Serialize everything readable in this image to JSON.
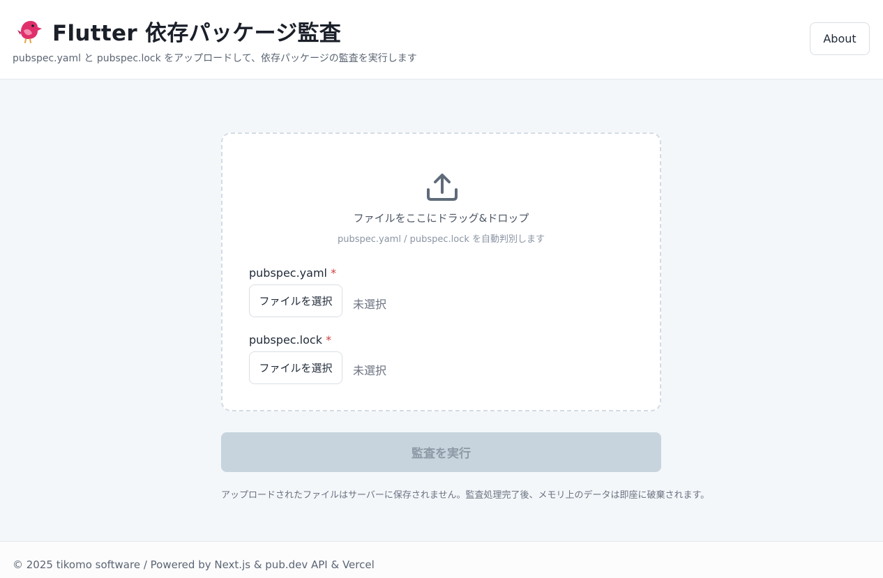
{
  "header": {
    "title": "Flutter 依存パッケージ監査",
    "subtitle": "pubspec.yaml と pubspec.lock をアップロードして、依存パッケージの監査を実行します",
    "logo_icon": "bird-logo-icon",
    "about_label": "About"
  },
  "dropzone": {
    "icon": "upload-icon",
    "main_text": "ファイルをここにドラッグ&ドロップ",
    "sub_text": "pubspec.yaml / pubspec.lock を自動判別します",
    "fields": [
      {
        "label": "pubspec.yaml",
        "required_mark": "*",
        "button_label": "ファイルを選択",
        "status": "未選択"
      },
      {
        "label": "pubspec.lock",
        "required_mark": "*",
        "button_label": "ファイルを選択",
        "status": "未選択"
      }
    ]
  },
  "actions": {
    "run_label": "監査を実行"
  },
  "notice": "アップロードされたファイルはサーバーに保存されません。監査処理完了後、メモリ上のデータは即座に破棄されます。",
  "footer": {
    "text": "© 2025 tikomo software / Powered by Next.js & pub.dev API & Vercel"
  },
  "colors": {
    "background": "#f4f7fa",
    "run_button_disabled": "#c7d4dd",
    "required_mark": "#d33b3b",
    "logo_pink": "#e0306c"
  }
}
